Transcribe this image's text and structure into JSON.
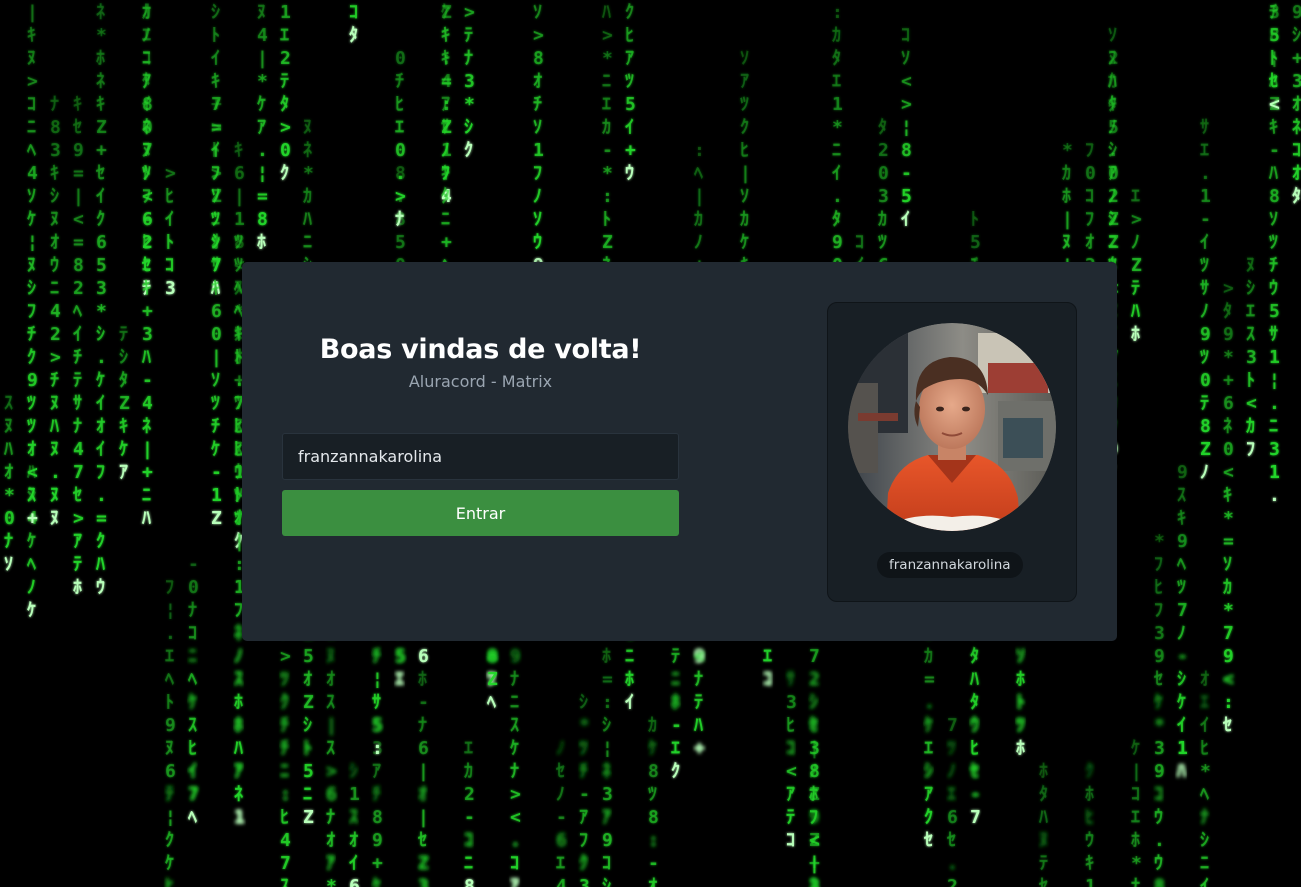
{
  "background": {
    "description_icon": "matrix-rain-background",
    "rain_color": "#24d82a",
    "bg_color": "#000000"
  },
  "login": {
    "title": "Boas vindas de volta!",
    "subtitle": "Aluracord - Matrix",
    "username_value": "franzannakarolina",
    "enter_label": "Entrar"
  },
  "profile": {
    "avatar_icon": "user-avatar-photo",
    "username": "franzannakarolina"
  },
  "colors": {
    "card": "#212931",
    "panel": "#181f25",
    "button": "#3b8f40",
    "title": "#ffffff",
    "subtitle": "#9aa5b1"
  }
}
